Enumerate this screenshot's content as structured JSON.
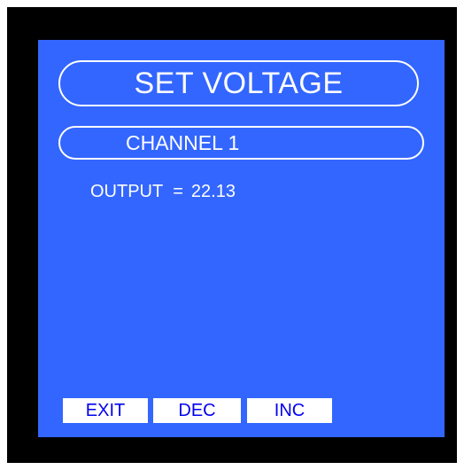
{
  "display": {
    "title": "SET VOLTAGE",
    "channel": "CHANNEL 1",
    "output_label": "OUTPUT",
    "equals": "=",
    "output_value": "22.13"
  },
  "softkeys": {
    "exit": "EXIT",
    "dec": "DEC",
    "inc": "INC"
  },
  "colors": {
    "bezel": "#000000",
    "screen": "#3366ff",
    "text": "#ffffff",
    "softkey_bg": "#ffffff",
    "softkey_text": "#0000ee"
  }
}
